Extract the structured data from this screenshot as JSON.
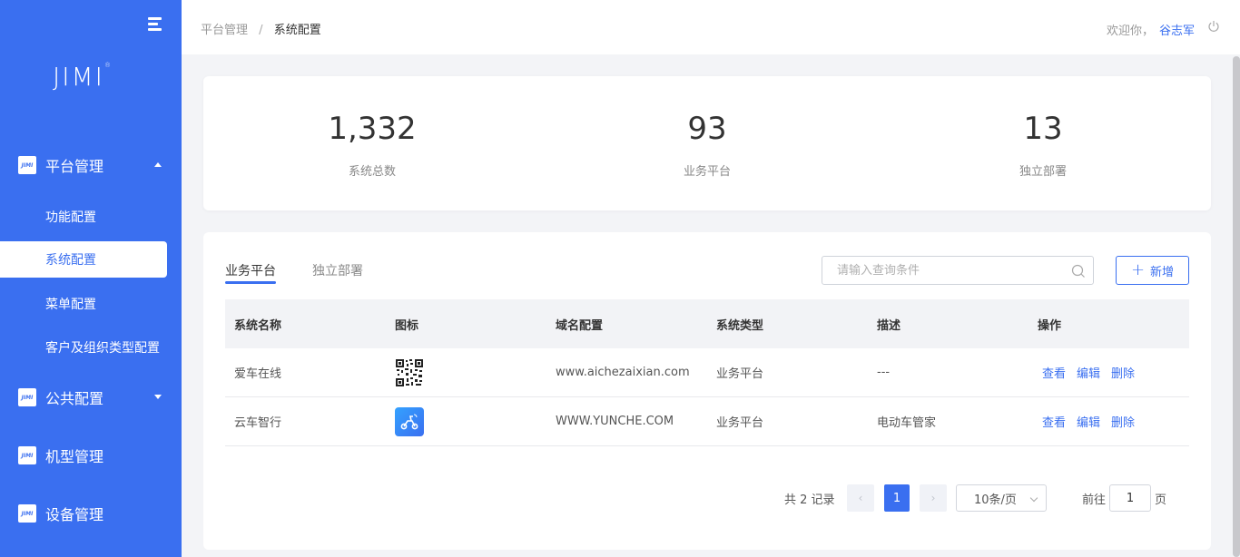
{
  "sidebar": {
    "logo": "JIMI",
    "logo_mark": "®",
    "menu_icon_text": "JIMI",
    "groups": [
      {
        "label": "平台管理",
        "expanded": true,
        "children": [
          {
            "label": "功能配置",
            "active": false
          },
          {
            "label": "系统配置",
            "active": true
          },
          {
            "label": "菜单配置",
            "active": false
          },
          {
            "label": "客户及组织类型配置",
            "active": false
          }
        ]
      },
      {
        "label": "公共配置",
        "expanded": false
      },
      {
        "label": "机型管理"
      },
      {
        "label": "设备管理"
      }
    ]
  },
  "header": {
    "breadcrumb": [
      "平台管理",
      "系统配置"
    ],
    "breadcrumb_sep": "/",
    "welcome": "欢迎你，",
    "username": "谷志军"
  },
  "stats": [
    {
      "value": "1,332",
      "label": "系统总数"
    },
    {
      "value": "93",
      "label": "业务平台"
    },
    {
      "value": "13",
      "label": "独立部署"
    }
  ],
  "tabs": [
    {
      "label": "业务平台",
      "active": true
    },
    {
      "label": "独立部署",
      "active": false
    }
  ],
  "search": {
    "placeholder": "请输入查询条件"
  },
  "add_button": {
    "label": "新增"
  },
  "table": {
    "columns": [
      "系统名称",
      "图标",
      "域名配置",
      "系统类型",
      "描述",
      "操作"
    ],
    "rows": [
      {
        "name": "爱车在线",
        "icon": "qr-code-icon",
        "domain": "www.aichezaixian.com",
        "type": "业务平台",
        "desc": "---",
        "actions": [
          "查看",
          "编辑",
          "删除"
        ]
      },
      {
        "name": "云车智行",
        "icon": "scooter-icon",
        "domain": "WWW.YUNCHE.COM",
        "type": "业务平台",
        "desc": "电动车管家",
        "actions": [
          "查看",
          "编辑",
          "删除"
        ]
      }
    ]
  },
  "pagination": {
    "total": "共 2 记录",
    "current": "1",
    "page_size": "10条/页",
    "goto_label": "前往",
    "goto_value": "1",
    "goto_suffix": "页"
  },
  "colors": {
    "accent": "#3a6ff0",
    "background": "#f3f4f7"
  }
}
